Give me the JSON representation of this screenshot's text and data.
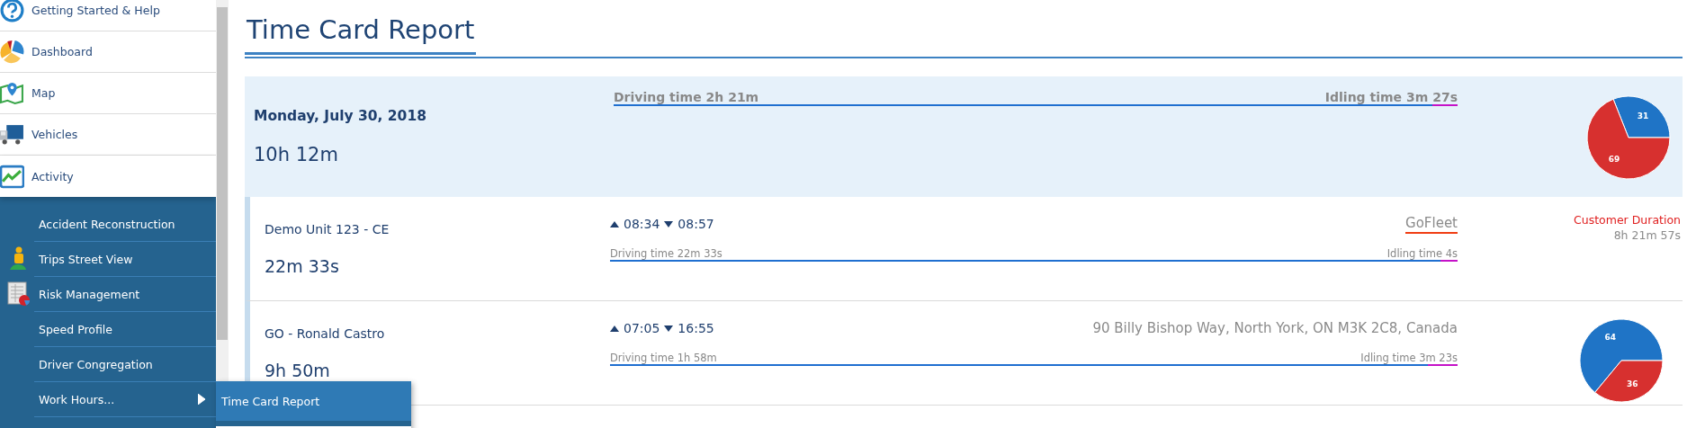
{
  "sidebar": {
    "items": [
      {
        "label": "Getting Started & Help",
        "expanded": false
      },
      {
        "label": "Dashboard",
        "expanded": false
      },
      {
        "label": "Map",
        "expanded": false
      },
      {
        "label": "Vehicles",
        "expanded": false
      },
      {
        "label": "Activity",
        "expanded": true,
        "children": [
          {
            "label": "Accident Reconstruction"
          },
          {
            "label": "Trips Street View"
          },
          {
            "label": "Risk Management"
          },
          {
            "label": "Speed Profile"
          },
          {
            "label": "Driver Congregation"
          },
          {
            "label": "Work Hours...",
            "expanded": true,
            "children": [
              {
                "label": "Time Card Report",
                "selected": true
              }
            ]
          }
        ]
      }
    ]
  },
  "page": {
    "title": "Time Card Report"
  },
  "summary": {
    "date": "Monday, July 30, 2018",
    "total": "10h 12m",
    "driving": "Driving time 2h 21m",
    "idling": "Idling time 3m 27s",
    "level": 0.97,
    "chart_data": {
      "type": "pie",
      "values": [
        31,
        69
      ],
      "data_labels": true
    }
  },
  "rows": [
    {
      "name": "Demo Unit 123 - CE",
      "duration": "22m 33s",
      "start": "08:34",
      "end": "08:57",
      "location": {
        "text": "GoFleet",
        "color": "#f03c12"
      },
      "driving": "Driving time 22m 33s",
      "idling": "Idling time 4s",
      "level": 0.98,
      "customer_duration": {
        "label": "Customer Duration",
        "value": "8h 21m 57s"
      }
    },
    {
      "name": "GO - Ronald Castro",
      "duration": "9h 50m",
      "start": "07:05",
      "end": "16:55",
      "location": {
        "text": "90 Billy Bishop Way, North York, ON M3K 2C8, Canada"
      },
      "driving": "Driving time 1h 58m",
      "idling": "Idling time 3m 23s",
      "level": 0.965,
      "chart_data": {
        "type": "pie",
        "values": [
          64,
          36
        ],
        "data_labels": true
      }
    }
  ]
}
